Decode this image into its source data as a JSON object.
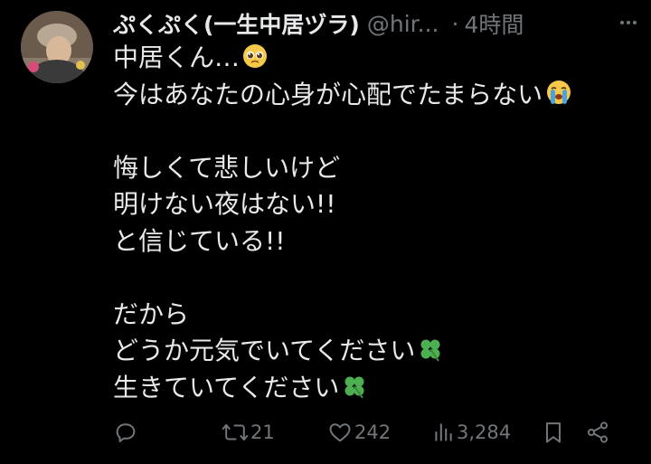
{
  "author": {
    "display_name": "ぷくぷく(一生中居ヅラ)",
    "handle": "@hir...",
    "separator": "·",
    "time": "4時間"
  },
  "tweet": {
    "lines": [
      "中居くん…",
      "今はあなたの心身が心配でたまらない",
      "",
      "悔しくて悲しいけど",
      "明けない夜はない!!",
      "と信じている!!",
      "",
      "だから",
      "どうか元気でいてください",
      "生きていてください"
    ]
  },
  "actions": {
    "reply_count": "",
    "retweet_count": "21",
    "like_count": "242",
    "view_count": "3,284"
  },
  "icons": {
    "reply": "reply-icon",
    "retweet": "retweet-icon",
    "like": "heart-icon",
    "views": "views-icon",
    "bookmark": "bookmark-icon",
    "share": "share-icon",
    "more": "more-icon"
  },
  "colors": {
    "background": "#000000",
    "text": "#e7e9ea",
    "secondary": "#71767b",
    "clover": "#4caf50"
  }
}
